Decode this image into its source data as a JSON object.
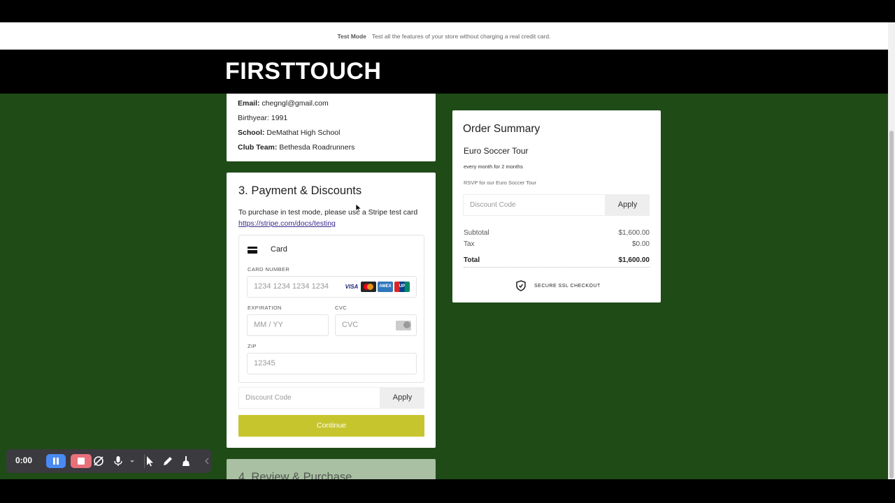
{
  "test_banner": {
    "label": "Test Mode",
    "message": "Test all the features of your store without charging a real credit card."
  },
  "header": {
    "logo": "FIRSTTOUCH"
  },
  "info": {
    "lines": [
      {
        "label": "Email:",
        "value": " chegngl@gmail.com"
      },
      {
        "label": "Birthyear:",
        "value": " 1991"
      },
      {
        "label": "School:",
        "value": " DeMathat High School"
      },
      {
        "label": "Club Team:",
        "value": " Bethesda Roadrunners"
      }
    ]
  },
  "payment": {
    "title": "3.  Payment & Discounts",
    "instructions": "To purchase in test mode, please use a Stripe test card",
    "link": "https://stripe.com/docs/testing",
    "card_tab": "Card",
    "card_number_label": "CARD NUMBER",
    "card_number_placeholder": "1234 1234 1234 1234",
    "expiration_label": "EXPIRATION",
    "expiration_placeholder": "MM / YY",
    "cvc_label": "CVC",
    "cvc_placeholder": "CVC",
    "zip_label": "ZIP",
    "zip_placeholder": "12345",
    "brands": [
      "VISA",
      "",
      "AMEX",
      "UP"
    ],
    "discount_placeholder": "Discount Code",
    "discount_apply": "Apply",
    "continue": "Continue"
  },
  "review": {
    "title": "4.  Review & Purchase"
  },
  "summary": {
    "title": "Order Summary",
    "product": "Euro Soccer Tour",
    "frequency": "every month for 2 months",
    "description": "RSVP for our Euro Soccer Tour",
    "discount_placeholder": "Discount Code",
    "discount_apply": "Apply",
    "subtotal_label": "Subtotal",
    "subtotal_value": "$1,600.00",
    "tax_label": "Tax",
    "tax_value": "$0.00",
    "total_label": "Total",
    "total_value": "$1,600.00",
    "ssl_text": "SECURE SSL CHECKOUT"
  },
  "recorder": {
    "time": "0:00",
    "accent": "#4a8af4",
    "stop_color": "#e8707a"
  },
  "colors": {
    "page_background": "#1f4b17",
    "continue_button": "#c7c52e",
    "link": "#3a2a8a"
  }
}
